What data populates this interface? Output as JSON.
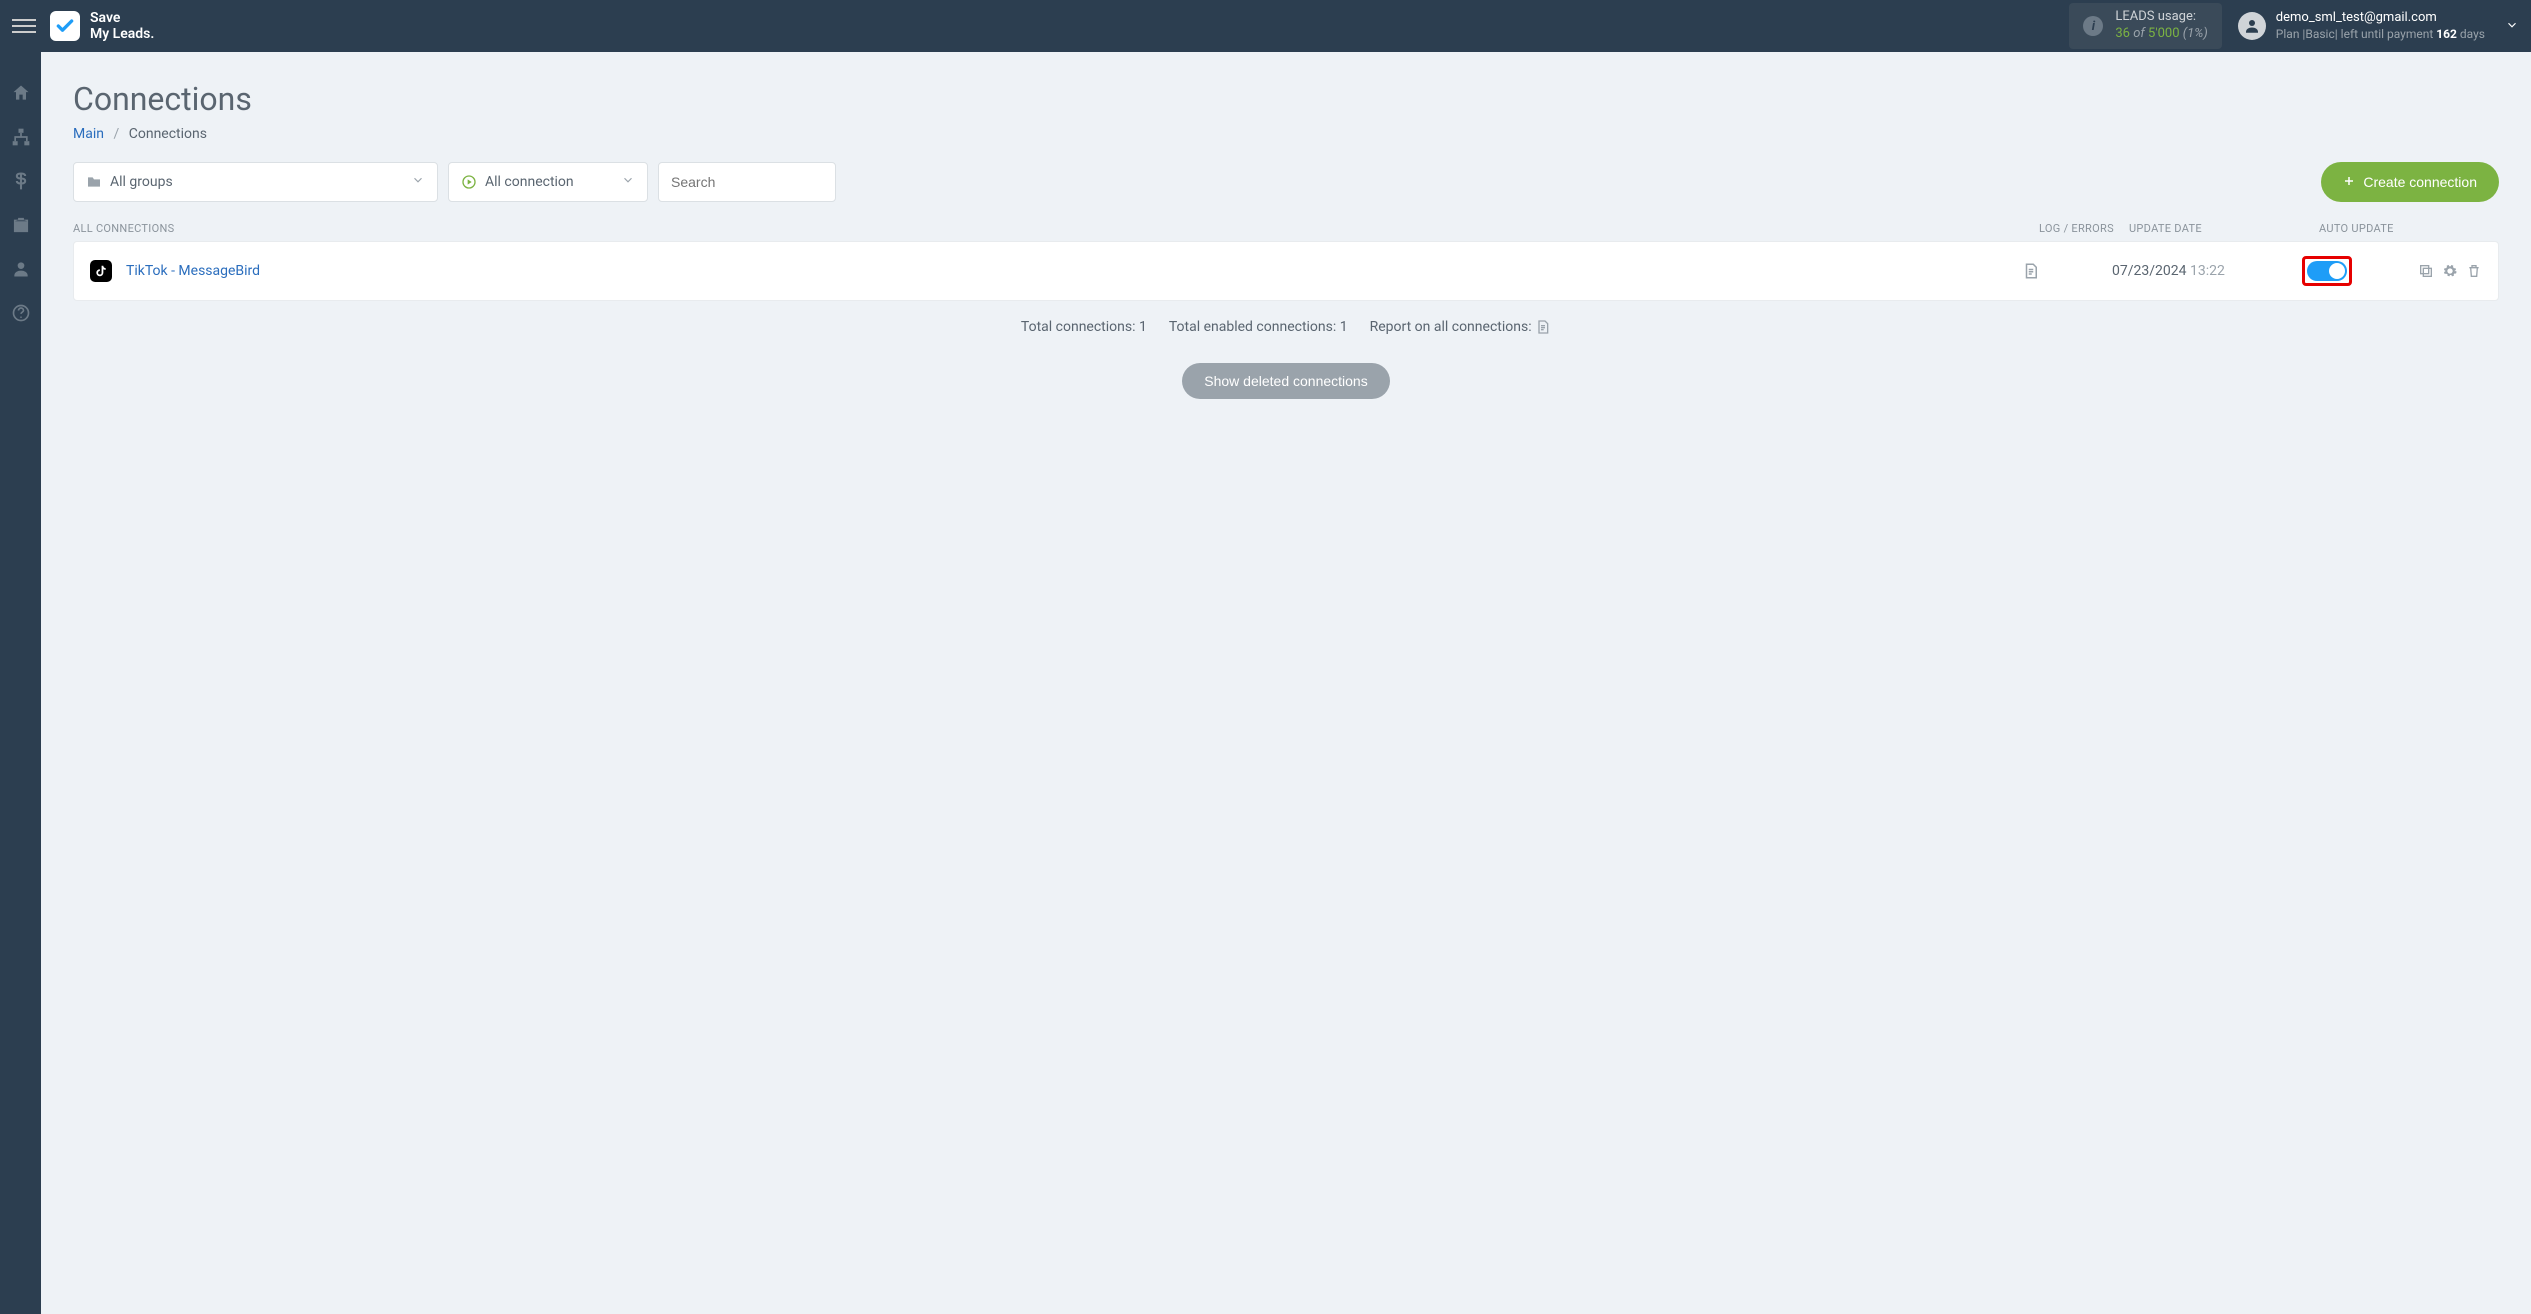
{
  "brand": {
    "line1": "Save",
    "line2": "My Leads."
  },
  "topbar": {
    "leads_label": "LEADS usage:",
    "leads_used": "36",
    "leads_of": "of",
    "leads_limit": "5'000",
    "leads_pct": "(1%)",
    "user_email": "demo_sml_test@gmail.com",
    "plan_prefix": "Plan |",
    "plan_name": "Basic",
    "plan_mid": "| left until payment ",
    "plan_days": "162",
    "plan_suffix": " days"
  },
  "page": {
    "title": "Connections",
    "breadcrumb_main": "Main",
    "breadcrumb_current": "Connections"
  },
  "filters": {
    "groups_label": "All groups",
    "status_label": "All connection",
    "search_placeholder": "Search",
    "create_label": "Create connection"
  },
  "table": {
    "th_name": "ALL CONNECTIONS",
    "th_log": "LOG / ERRORS",
    "th_date": "UPDATE DATE",
    "th_auto": "AUTO UPDATE"
  },
  "rows": [
    {
      "name": "TikTok - MessageBird",
      "date": "07/23/2024",
      "time": "13:22"
    }
  ],
  "summary": {
    "total_label": "Total connections: ",
    "total_value": "1",
    "enabled_label": "Total enabled connections: ",
    "enabled_value": "1",
    "report_label": "Report on all connections: "
  },
  "show_deleted": "Show deleted connections"
}
